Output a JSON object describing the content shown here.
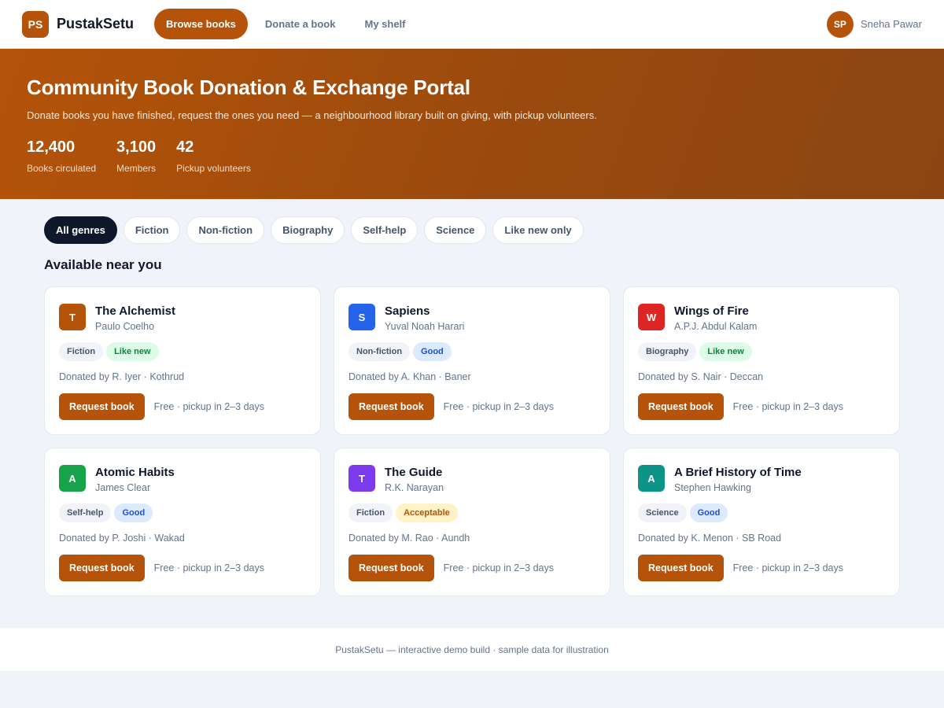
{
  "header": {
    "logo_initials": "PS",
    "brand": "PustakSetu",
    "nav": [
      {
        "label": "Browse books",
        "active": true
      },
      {
        "label": "Donate a book",
        "active": false
      },
      {
        "label": "My shelf",
        "active": false
      }
    ],
    "user": {
      "initials": "SP",
      "name": "Sneha Pawar"
    }
  },
  "hero": {
    "title": "Community Book Donation & Exchange Portal",
    "subtitle": "Donate books you have finished, request the ones you need — a neighbourhood library built on giving, with pickup volunteers.",
    "stats": [
      {
        "value": "12,400",
        "label": "Books circulated"
      },
      {
        "value": "3,100",
        "label": "Members"
      },
      {
        "value": "42",
        "label": "Pickup volunteers"
      }
    ]
  },
  "filters": [
    {
      "label": "All genres",
      "active": true
    },
    {
      "label": "Fiction",
      "active": false
    },
    {
      "label": "Non-fiction",
      "active": false
    },
    {
      "label": "Biography",
      "active": false
    },
    {
      "label": "Self-help",
      "active": false
    },
    {
      "label": "Science",
      "active": false
    },
    {
      "label": "Like new only",
      "active": false
    }
  ],
  "section_title": "Available near you",
  "books": [
    {
      "initial": "T",
      "color": "#b45309",
      "title": "The Alchemist",
      "author": "Paulo Coelho",
      "genre": "Fiction",
      "condition": "Like new",
      "condition_style": "cond-likenew",
      "donor": "Donated by R. Iyer · Kothrud",
      "button": "Request book",
      "pickup": "Free · pickup in 2–3 days"
    },
    {
      "initial": "S",
      "color": "#2563eb",
      "title": "Sapiens",
      "author": "Yuval Noah Harari",
      "genre": "Non-fiction",
      "condition": "Good",
      "condition_style": "cond-good",
      "donor": "Donated by A. Khan · Baner",
      "button": "Request book",
      "pickup": "Free · pickup in 2–3 days"
    },
    {
      "initial": "W",
      "color": "#dc2626",
      "title": "Wings of Fire",
      "author": "A.P.J. Abdul Kalam",
      "genre": "Biography",
      "condition": "Like new",
      "condition_style": "cond-likenew",
      "donor": "Donated by S. Nair · Deccan",
      "button": "Request book",
      "pickup": "Free · pickup in 2–3 days"
    },
    {
      "initial": "A",
      "color": "#16a34a",
      "title": "Atomic Habits",
      "author": "James Clear",
      "genre": "Self-help",
      "condition": "Good",
      "condition_style": "cond-good",
      "donor": "Donated by P. Joshi · Wakad",
      "button": "Request book",
      "pickup": "Free · pickup in 2–3 days"
    },
    {
      "initial": "T",
      "color": "#7c3aed",
      "title": "The Guide",
      "author": "R.K. Narayan",
      "genre": "Fiction",
      "condition": "Acceptable",
      "condition_style": "cond-acceptable",
      "donor": "Donated by M. Rao · Aundh",
      "button": "Request book",
      "pickup": "Free · pickup in 2–3 days"
    },
    {
      "initial": "A",
      "color": "#0d9488",
      "title": "A Brief History of Time",
      "author": "Stephen Hawking",
      "genre": "Science",
      "condition": "Good",
      "condition_style": "cond-good",
      "donor": "Donated by K. Menon · SB Road",
      "button": "Request book",
      "pickup": "Free · pickup in 2–3 days"
    }
  ],
  "footer": {
    "text": "PustakSetu — interactive demo build · sample data for illustration"
  }
}
